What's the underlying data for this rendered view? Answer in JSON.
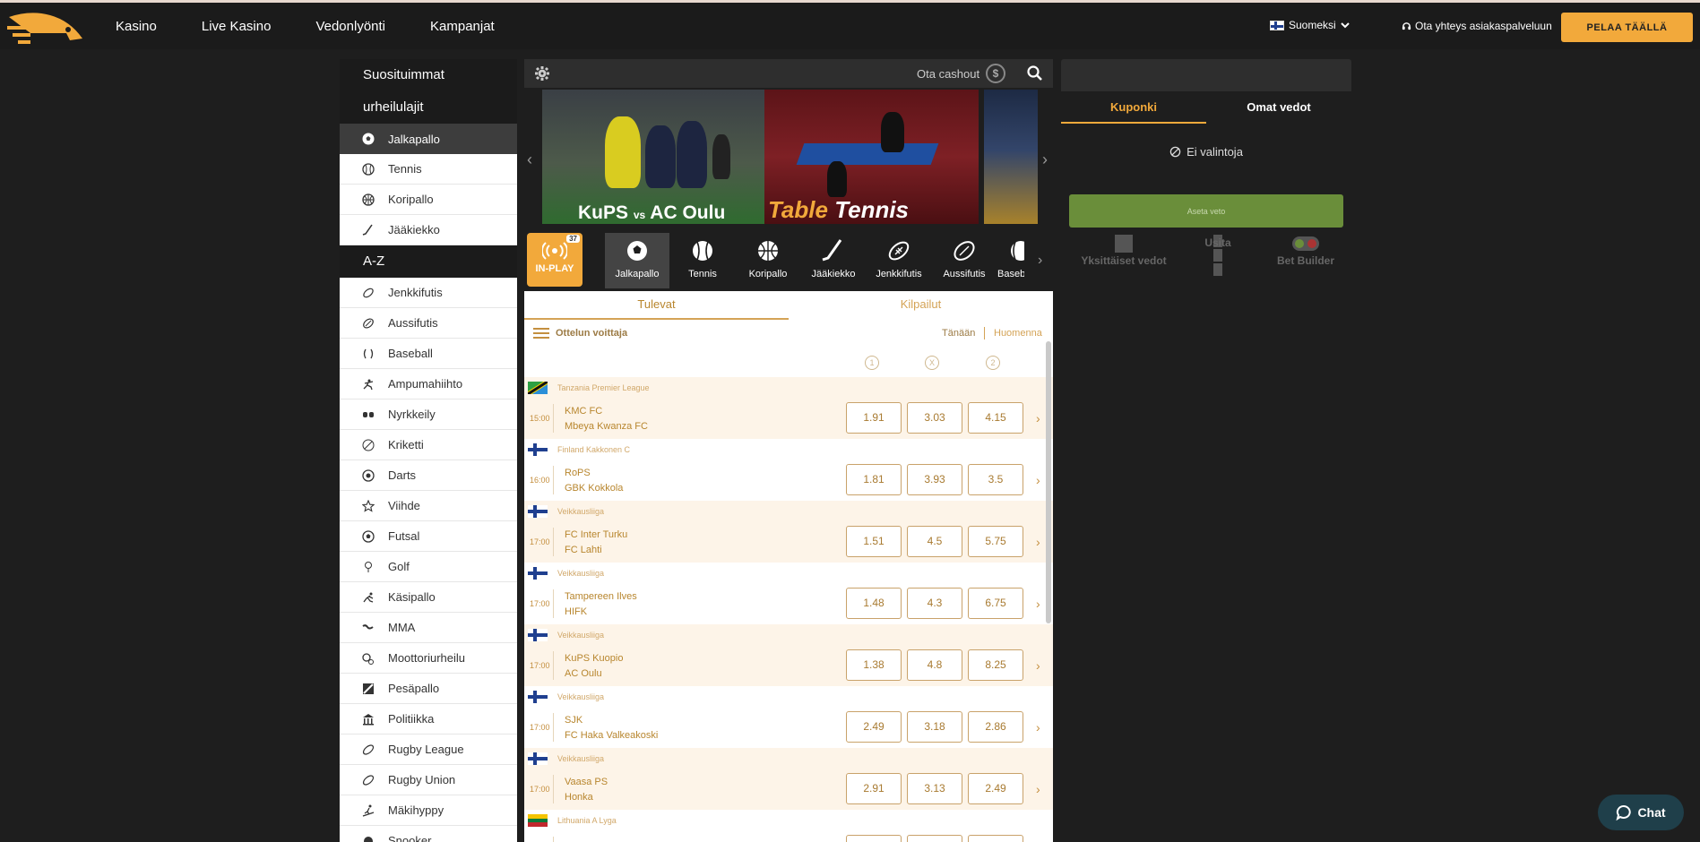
{
  "header": {
    "nav": [
      "Kasino",
      "Live Kasino",
      "Vedonlyönti",
      "Kampanjat"
    ],
    "language": "Suomeksi",
    "support": "Ota yhteys asiakaspalveluun",
    "play_button": "PELAA TÄÄLLÄ"
  },
  "sidebar": {
    "popular_title_1": "Suosituimmat",
    "popular_title_2": "urheilulajit",
    "popular": [
      {
        "label": "Jalkapallo",
        "icon": "soccer-ball-icon"
      },
      {
        "label": "Tennis",
        "icon": "tennis-ball-icon"
      },
      {
        "label": "Koripallo",
        "icon": "basketball-icon"
      },
      {
        "label": "Jääkiekko",
        "icon": "hockey-stick-icon"
      }
    ],
    "az_title": "A-Z",
    "az": [
      {
        "label": "Jenkkifutis",
        "icon": "american-football-icon"
      },
      {
        "label": "Aussifutis",
        "icon": "aussie-football-icon"
      },
      {
        "label": "Baseball",
        "icon": "baseball-icon"
      },
      {
        "label": "Ampumahiihto",
        "icon": "biathlon-icon"
      },
      {
        "label": "Nyrkkeily",
        "icon": "boxing-gloves-icon"
      },
      {
        "label": "Kriketti",
        "icon": "cricket-ball-icon"
      },
      {
        "label": "Darts",
        "icon": "dartboard-icon"
      },
      {
        "label": "Viihde",
        "icon": "star-icon"
      },
      {
        "label": "Futsal",
        "icon": "futsal-ball-icon"
      },
      {
        "label": "Golf",
        "icon": "golf-icon"
      },
      {
        "label": "Käsipallo",
        "icon": "handball-icon"
      },
      {
        "label": "MMA",
        "icon": "mma-icon"
      },
      {
        "label": "Moottoriurheilu",
        "icon": "motorsport-icon"
      },
      {
        "label": "Pesäpallo",
        "icon": "pesapallo-icon"
      },
      {
        "label": "Politiikka",
        "icon": "government-building-icon"
      },
      {
        "label": "Rugby League",
        "icon": "rugby-ball-icon"
      },
      {
        "label": "Rugby Union",
        "icon": "rugby-ball-icon"
      },
      {
        "label": "Mäkihyppy",
        "icon": "ski-jump-icon"
      },
      {
        "label": "Snooker",
        "icon": "snooker-icon"
      }
    ]
  },
  "toolbar": {
    "cashout_label": "Ota cashout",
    "cashout_coin": "$"
  },
  "banners": {
    "b1_team1": "KuPS",
    "b1_vs": "vs",
    "b1_team2": "AC Oulu",
    "b2_word1": "Table",
    "b2_word2": "Tennis"
  },
  "sportsbar": {
    "inplay_label": "IN-PLAY",
    "inplay_count": "37",
    "sports": [
      "Jalkapallo",
      "Tennis",
      "Koripallo",
      "Jääkiekko",
      "Jenkkifutis",
      "Aussifutis",
      "Baseball"
    ]
  },
  "content": {
    "tabs": [
      "Tulevat",
      "Kilpailut"
    ],
    "market": "Ottelun voittaja",
    "day_today": "Tänään",
    "day_tomorrow": "Huomenna",
    "odd_headers": [
      "1",
      "X",
      "2"
    ],
    "events": [
      {
        "league": "Tanzania Premier League",
        "flag": "tanzania",
        "time": "15:00",
        "home": "KMC FC",
        "away": "Mbeya Kwanza FC",
        "odds": [
          "1.91",
          "3.03",
          "4.15"
        ]
      },
      {
        "league": "Finland Kakkonen C",
        "flag": "finland",
        "time": "16:00",
        "home": "RoPS",
        "away": "GBK Kokkola",
        "odds": [
          "1.81",
          "3.93",
          "3.5"
        ]
      },
      {
        "league": "Veikkausliiga",
        "flag": "finland",
        "time": "17:00",
        "home": "FC Inter Turku",
        "away": "FC Lahti",
        "odds": [
          "1.51",
          "4.5",
          "5.75"
        ]
      },
      {
        "league": "Veikkausliiga",
        "flag": "finland",
        "time": "17:00",
        "home": "Tampereen Ilves",
        "away": "HIFK",
        "odds": [
          "1.48",
          "4.3",
          "6.75"
        ]
      },
      {
        "league": "Veikkausliiga",
        "flag": "finland",
        "time": "17:00",
        "home": "KuPS Kuopio",
        "away": "AC Oulu",
        "odds": [
          "1.38",
          "4.8",
          "8.25"
        ]
      },
      {
        "league": "Veikkausliiga",
        "flag": "finland",
        "time": "17:00",
        "home": "SJK",
        "away": "FC Haka Valkeakoski",
        "odds": [
          "2.49",
          "3.18",
          "2.86"
        ]
      },
      {
        "league": "Veikkausliiga",
        "flag": "finland",
        "time": "17:00",
        "home": "Vaasa PS",
        "away": "Honka",
        "odds": [
          "2.91",
          "3.13",
          "2.49"
        ]
      },
      {
        "league": "Lithuania A Lyga",
        "flag": "lithuania",
        "time": "",
        "home": "",
        "away": "",
        "odds": [
          "",
          "",
          ""
        ]
      }
    ]
  },
  "betslip": {
    "tabs": [
      "Kuponki",
      "Omat vedot"
    ],
    "empty": "Ei valintoja",
    "place_bet": "Aseta veto",
    "modes": [
      "Yksittäiset vedot",
      "Usita",
      "Bet Builder"
    ]
  },
  "chat": {
    "label": "Chat"
  },
  "colors": {
    "accent": "#f2a93b",
    "odds_text": "#a87a30",
    "bet_green": "#6a8e3a"
  }
}
